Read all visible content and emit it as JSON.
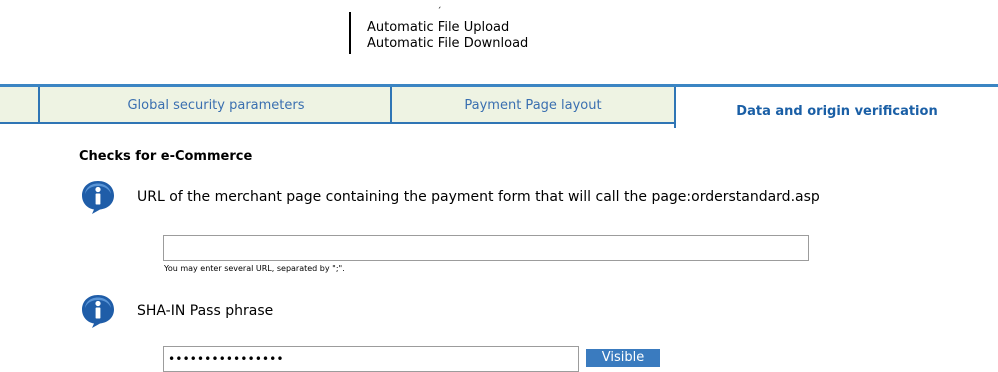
{
  "top_menu": {
    "items": [
      "Automatic File Upload",
      "Automatic File Download"
    ]
  },
  "tabs": {
    "items": [
      "Global security parameters",
      "Payment Page layout",
      "Data and origin verification"
    ],
    "active": "Data and origin verification"
  },
  "section": {
    "title": "Checks for e-Commerce"
  },
  "url_field": {
    "label": "URL of the merchant page containing the payment form that will call the page:orderstandard.asp",
    "value": "",
    "hint": "You may enter several URL, separated by \";\"."
  },
  "sha_field": {
    "label": "SHA-IN Pass phrase",
    "value": "••••••••••••••••",
    "visible_label": "Visible"
  },
  "colors": {
    "tab_bg": "#eef3e3",
    "tab_border": "#2f75b5",
    "tab_text": "#3a6fb0",
    "active_tab_text": "#1a5fa6",
    "button_bg": "#3a7bbf"
  }
}
